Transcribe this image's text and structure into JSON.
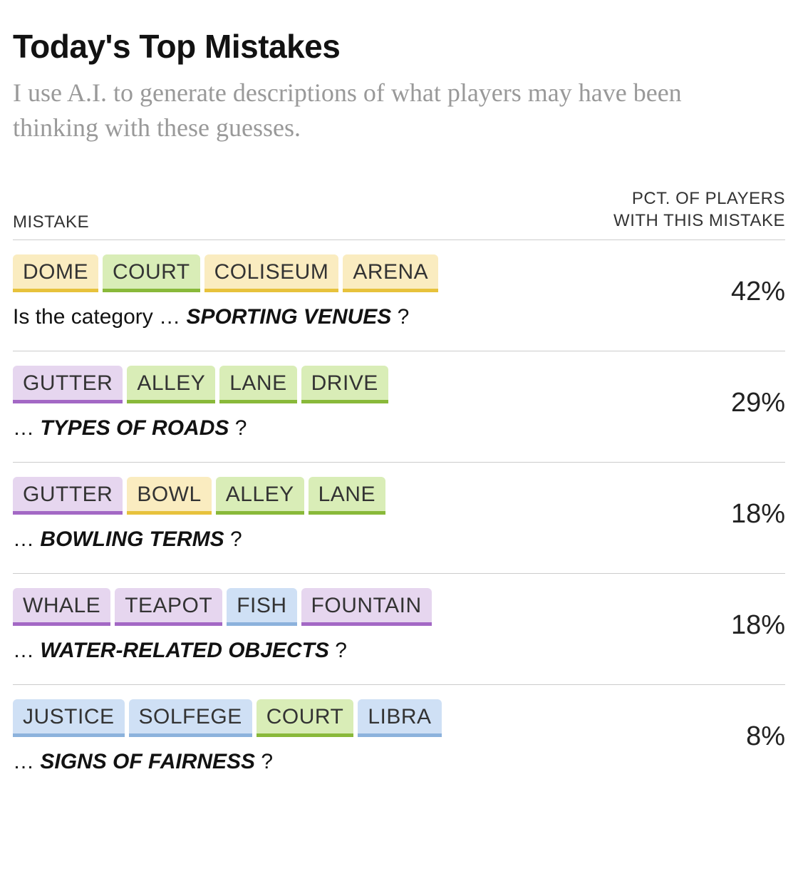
{
  "title": "Today's Top Mistakes",
  "intro": "I use A.I. to generate descriptions of what players may have been thinking with these guesses.",
  "headers": {
    "left": "MISTAKE",
    "right_line1": "PCT. OF PLAYERS",
    "right_line2": "WITH THIS MISTAKE"
  },
  "rows": [
    {
      "tiles": [
        {
          "word": "DOME",
          "color": "yellow"
        },
        {
          "word": "COURT",
          "color": "green"
        },
        {
          "word": "COLISEUM",
          "color": "yellow"
        },
        {
          "word": "ARENA",
          "color": "yellow"
        }
      ],
      "prefix": "Is the category … ",
      "category": "SPORTING VENUES",
      "suffix": " ?",
      "pct": "42%"
    },
    {
      "tiles": [
        {
          "word": "GUTTER",
          "color": "purple"
        },
        {
          "word": "ALLEY",
          "color": "green"
        },
        {
          "word": "LANE",
          "color": "green"
        },
        {
          "word": "DRIVE",
          "color": "green"
        }
      ],
      "prefix": "… ",
      "category": "TYPES OF ROADS",
      "suffix": " ?",
      "pct": "29%"
    },
    {
      "tiles": [
        {
          "word": "GUTTER",
          "color": "purple"
        },
        {
          "word": "BOWL",
          "color": "yellow"
        },
        {
          "word": "ALLEY",
          "color": "green"
        },
        {
          "word": "LANE",
          "color": "green"
        }
      ],
      "prefix": "… ",
      "category": "BOWLING TERMS",
      "suffix": " ?",
      "pct": "18%"
    },
    {
      "tiles": [
        {
          "word": "WHALE",
          "color": "purple"
        },
        {
          "word": "TEAPOT",
          "color": "purple"
        },
        {
          "word": "FISH",
          "color": "blue"
        },
        {
          "word": "FOUNTAIN",
          "color": "purple"
        }
      ],
      "prefix": "… ",
      "category": "WATER-RELATED OBJECTS",
      "suffix": " ?",
      "pct": "18%"
    },
    {
      "tiles": [
        {
          "word": "JUSTICE",
          "color": "blue"
        },
        {
          "word": "SOLFEGE",
          "color": "blue"
        },
        {
          "word": "COURT",
          "color": "green"
        },
        {
          "word": "LIBRA",
          "color": "blue"
        }
      ],
      "prefix": "… ",
      "category": "SIGNS OF FAIRNESS",
      "suffix": " ?",
      "pct": "8%"
    }
  ]
}
